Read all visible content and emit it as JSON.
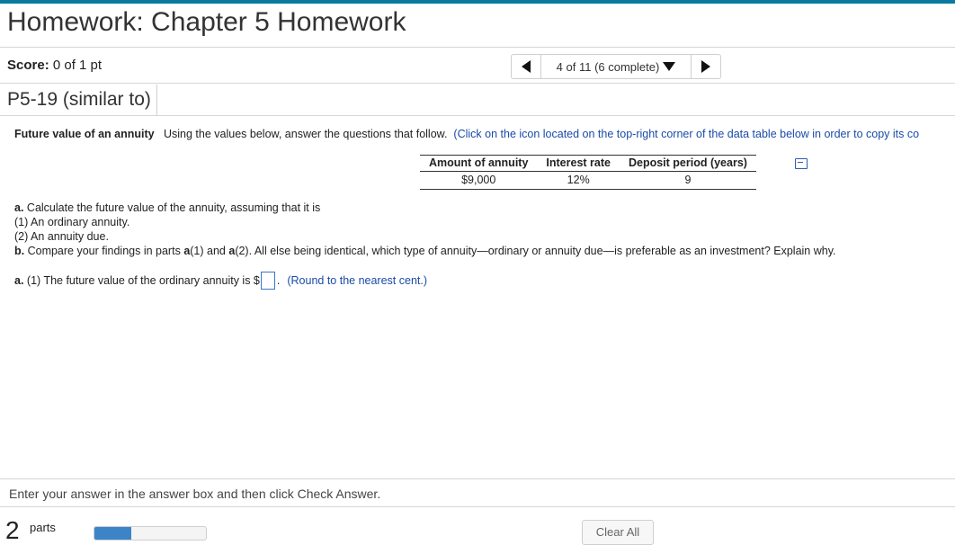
{
  "page_title": "Homework: Chapter 5 Homework",
  "score": {
    "label": "Score:",
    "value": "0 of 1 pt"
  },
  "nav": {
    "position": "4 of 11 (6 complete)"
  },
  "question_id": "P5-19 (similar to)",
  "problem": {
    "title": "Future value of an annuity",
    "intro": "Using the values below, answer the questions that follow.",
    "instruction": "(Click on the icon located on the top-right corner of the data table below in order to copy its co"
  },
  "data_table": {
    "headers": [
      "Amount of annuity",
      "Interest rate",
      "Deposit period (years)"
    ],
    "row": [
      "$9,000",
      "12%",
      "9"
    ]
  },
  "questions": {
    "a_label": "a.",
    "a_text": "Calculate the future value of the annuity, assuming that it is",
    "a1": "(1) An ordinary annuity.",
    "a2": "(2) An annuity due.",
    "b_label": "b.",
    "b_text_1": "Compare your findings in parts",
    "b_a1": "a",
    "b_a1_suffix": "(1) and",
    "b_a2": "a",
    "b_text_2": "(2). All else being identical, which type of annuity—ordinary or annuity due—is preferable as an investment? Explain why."
  },
  "answer": {
    "label": "a.",
    "prefix": "(1) The future value of the ordinary annuity is $",
    "value": "",
    "suffix": ".",
    "hint": "(Round to the nearest cent.)"
  },
  "footer": {
    "message": "Enter your answer in the answer box and then click Check Answer.",
    "parts_count": "2",
    "parts_label": "parts",
    "progress_fraction": 0.33,
    "clear_all": "Clear All"
  },
  "colors": {
    "accent": "#0b7a9e",
    "link": "#1a4ba8",
    "progress": "#3d84c6"
  }
}
